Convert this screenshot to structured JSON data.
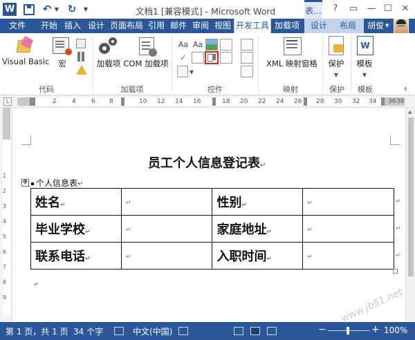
{
  "titlebar": {
    "title": "文档1 [兼容模式] - Microsoft Word",
    "context_tab_head": "表...",
    "help": "?",
    "minimize": "—",
    "maximize": "☐",
    "close": "✕"
  },
  "tabs": {
    "file": "文件",
    "items": [
      "开始",
      "插入",
      "设计",
      "页面布局",
      "引用",
      "邮件",
      "审阅",
      "视图",
      "开发工具",
      "加载项"
    ],
    "active": "开发工具",
    "context": [
      "设计",
      "布局"
    ],
    "user": "胡俊"
  },
  "ribbon": {
    "groups": {
      "code": "代码",
      "addins": "加载项",
      "controls": "控件",
      "mapping": "映射",
      "protect": "保护",
      "templates": "模板"
    },
    "buttons": {
      "visual_basic": "Visual Basic",
      "macro": "宏",
      "addins": "加载项",
      "com_addins": "COM 加载项",
      "xml_mapping": "XML 映射窗格",
      "protect": "保护",
      "template": "模板"
    },
    "controls": {
      "text_aa1": "Aa",
      "text_aa2": "Aa"
    }
  },
  "ruler": {
    "numbers": [
      "2",
      "4",
      "6",
      "8",
      "10",
      "12",
      "14",
      "16",
      "18",
      "20",
      "22",
      "24",
      "26",
      "28",
      "30",
      "32",
      "34",
      "36",
      "38"
    ],
    "corner": "L"
  },
  "vruler": {
    "numbers": [
      "1",
      "2",
      "3",
      "4",
      "5",
      "6",
      "7",
      "8",
      "9"
    ]
  },
  "document": {
    "title": "员工个人信息登记表",
    "para_mark": "↵",
    "caption": "个人信息表",
    "table": [
      [
        "姓名",
        "",
        "性别",
        ""
      ],
      [
        "毕业学校",
        "",
        "家庭地址",
        ""
      ],
      [
        "联系电话",
        "",
        "入职时间",
        ""
      ]
    ],
    "cell_mark": "↵"
  },
  "statusbar": {
    "page": "第 1 页，共 1 页",
    "words": "34 个字",
    "language": "中文(中国)",
    "zoom": "100%",
    "zoom_minus": "−",
    "zoom_plus": "+"
  },
  "watermark": "www.jb51.net",
  "colors": {
    "accent": "#2b579a",
    "highlight": "#d9261c"
  }
}
